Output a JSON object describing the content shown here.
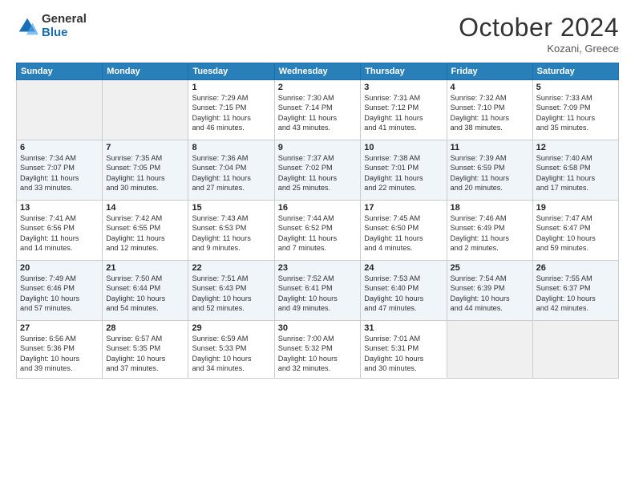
{
  "header": {
    "logo_general": "General",
    "logo_blue": "Blue",
    "month_title": "October 2024",
    "location": "Kozani, Greece"
  },
  "days_of_week": [
    "Sunday",
    "Monday",
    "Tuesday",
    "Wednesday",
    "Thursday",
    "Friday",
    "Saturday"
  ],
  "weeks": [
    [
      {
        "day": "",
        "info": ""
      },
      {
        "day": "",
        "info": ""
      },
      {
        "day": "1",
        "info": "Sunrise: 7:29 AM\nSunset: 7:15 PM\nDaylight: 11 hours\nand 46 minutes."
      },
      {
        "day": "2",
        "info": "Sunrise: 7:30 AM\nSunset: 7:14 PM\nDaylight: 11 hours\nand 43 minutes."
      },
      {
        "day": "3",
        "info": "Sunrise: 7:31 AM\nSunset: 7:12 PM\nDaylight: 11 hours\nand 41 minutes."
      },
      {
        "day": "4",
        "info": "Sunrise: 7:32 AM\nSunset: 7:10 PM\nDaylight: 11 hours\nand 38 minutes."
      },
      {
        "day": "5",
        "info": "Sunrise: 7:33 AM\nSunset: 7:09 PM\nDaylight: 11 hours\nand 35 minutes."
      }
    ],
    [
      {
        "day": "6",
        "info": "Sunrise: 7:34 AM\nSunset: 7:07 PM\nDaylight: 11 hours\nand 33 minutes."
      },
      {
        "day": "7",
        "info": "Sunrise: 7:35 AM\nSunset: 7:05 PM\nDaylight: 11 hours\nand 30 minutes."
      },
      {
        "day": "8",
        "info": "Sunrise: 7:36 AM\nSunset: 7:04 PM\nDaylight: 11 hours\nand 27 minutes."
      },
      {
        "day": "9",
        "info": "Sunrise: 7:37 AM\nSunset: 7:02 PM\nDaylight: 11 hours\nand 25 minutes."
      },
      {
        "day": "10",
        "info": "Sunrise: 7:38 AM\nSunset: 7:01 PM\nDaylight: 11 hours\nand 22 minutes."
      },
      {
        "day": "11",
        "info": "Sunrise: 7:39 AM\nSunset: 6:59 PM\nDaylight: 11 hours\nand 20 minutes."
      },
      {
        "day": "12",
        "info": "Sunrise: 7:40 AM\nSunset: 6:58 PM\nDaylight: 11 hours\nand 17 minutes."
      }
    ],
    [
      {
        "day": "13",
        "info": "Sunrise: 7:41 AM\nSunset: 6:56 PM\nDaylight: 11 hours\nand 14 minutes."
      },
      {
        "day": "14",
        "info": "Sunrise: 7:42 AM\nSunset: 6:55 PM\nDaylight: 11 hours\nand 12 minutes."
      },
      {
        "day": "15",
        "info": "Sunrise: 7:43 AM\nSunset: 6:53 PM\nDaylight: 11 hours\nand 9 minutes."
      },
      {
        "day": "16",
        "info": "Sunrise: 7:44 AM\nSunset: 6:52 PM\nDaylight: 11 hours\nand 7 minutes."
      },
      {
        "day": "17",
        "info": "Sunrise: 7:45 AM\nSunset: 6:50 PM\nDaylight: 11 hours\nand 4 minutes."
      },
      {
        "day": "18",
        "info": "Sunrise: 7:46 AM\nSunset: 6:49 PM\nDaylight: 11 hours\nand 2 minutes."
      },
      {
        "day": "19",
        "info": "Sunrise: 7:47 AM\nSunset: 6:47 PM\nDaylight: 10 hours\nand 59 minutes."
      }
    ],
    [
      {
        "day": "20",
        "info": "Sunrise: 7:49 AM\nSunset: 6:46 PM\nDaylight: 10 hours\nand 57 minutes."
      },
      {
        "day": "21",
        "info": "Sunrise: 7:50 AM\nSunset: 6:44 PM\nDaylight: 10 hours\nand 54 minutes."
      },
      {
        "day": "22",
        "info": "Sunrise: 7:51 AM\nSunset: 6:43 PM\nDaylight: 10 hours\nand 52 minutes."
      },
      {
        "day": "23",
        "info": "Sunrise: 7:52 AM\nSunset: 6:41 PM\nDaylight: 10 hours\nand 49 minutes."
      },
      {
        "day": "24",
        "info": "Sunrise: 7:53 AM\nSunset: 6:40 PM\nDaylight: 10 hours\nand 47 minutes."
      },
      {
        "day": "25",
        "info": "Sunrise: 7:54 AM\nSunset: 6:39 PM\nDaylight: 10 hours\nand 44 minutes."
      },
      {
        "day": "26",
        "info": "Sunrise: 7:55 AM\nSunset: 6:37 PM\nDaylight: 10 hours\nand 42 minutes."
      }
    ],
    [
      {
        "day": "27",
        "info": "Sunrise: 6:56 AM\nSunset: 5:36 PM\nDaylight: 10 hours\nand 39 minutes."
      },
      {
        "day": "28",
        "info": "Sunrise: 6:57 AM\nSunset: 5:35 PM\nDaylight: 10 hours\nand 37 minutes."
      },
      {
        "day": "29",
        "info": "Sunrise: 6:59 AM\nSunset: 5:33 PM\nDaylight: 10 hours\nand 34 minutes."
      },
      {
        "day": "30",
        "info": "Sunrise: 7:00 AM\nSunset: 5:32 PM\nDaylight: 10 hours\nand 32 minutes."
      },
      {
        "day": "31",
        "info": "Sunrise: 7:01 AM\nSunset: 5:31 PM\nDaylight: 10 hours\nand 30 minutes."
      },
      {
        "day": "",
        "info": ""
      },
      {
        "day": "",
        "info": ""
      }
    ]
  ]
}
